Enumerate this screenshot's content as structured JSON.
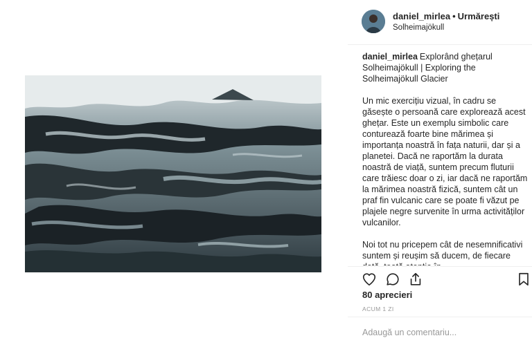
{
  "post": {
    "username": "daniel_mirlea",
    "separator": "•",
    "follow_label": "Urmărești",
    "location": "Solheimajökull"
  },
  "caption": {
    "username": "daniel_mirlea",
    "title": "Explorând ghețarul Solheimajökull | Exploring the Solheimajökull Glacier",
    "paragraph_1": "Un mic exercițiu vizual, în cadru se găsește o persoană care explorează acest ghețar. Este un exemplu simbolic care conturează foarte bine mărimea și importanța noastră în fața naturii, dar și a planetei. Dacă ne raportăm la durata noastră de viață, suntem precum fluturii care trăiesc doar o zi, iar dacă ne raportăm la mărimea noastră fizică, suntem cât un praf fin vulcanic care se poate fi văzut pe plajele negre survenite în urma activităților vulcanilor.",
    "paragraph_2": "Noi tot nu pricepem cât de nesemnificativi suntem și reușim să ducem, de fiecare dată, toată atenția în"
  },
  "stats": {
    "likes": "80 aprecieri",
    "time": "ACUM 1 ZI"
  },
  "comment": {
    "placeholder": "Adaugă un comentariu..."
  },
  "icons": {
    "like": "heart-icon",
    "comment": "comment-bubble-icon",
    "share": "share-icon",
    "save": "bookmark-icon"
  },
  "colors": {
    "text": "#262626",
    "muted": "#999999",
    "divider": "#efefef"
  }
}
